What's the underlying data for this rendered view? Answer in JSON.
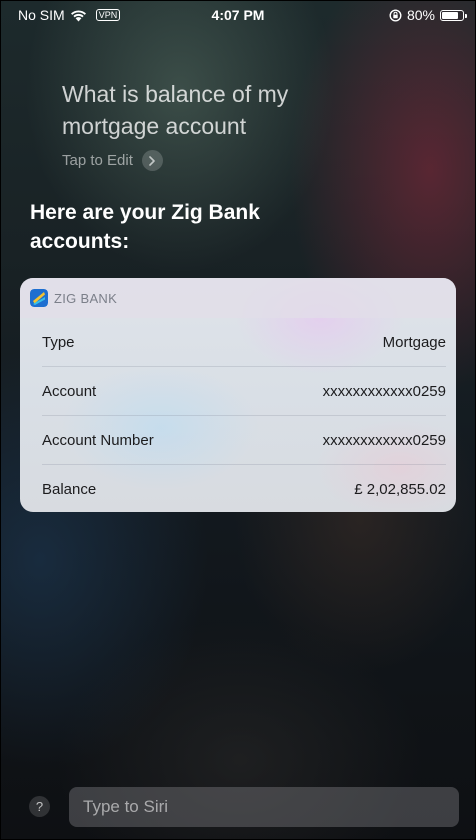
{
  "status_bar": {
    "carrier": "No SIM",
    "vpn": "VPN",
    "time": "4:07 PM",
    "battery_text": "80%",
    "battery_level": 0.8,
    "icons": [
      "wifi-icon",
      "rotation-lock-icon",
      "battery-icon"
    ]
  },
  "siri": {
    "query": "What is balance of my mortgage account",
    "tap_to_edit": "Tap to Edit",
    "response": "Here are your Zig Bank accounts:"
  },
  "card": {
    "app_name": "ZIG BANK",
    "rows": [
      {
        "label": "Type",
        "value": "Mortgage"
      },
      {
        "label": "Account",
        "value": "xxxxxxxxxxxx0259"
      },
      {
        "label": "Account Number",
        "value": "xxxxxxxxxxxx0259"
      },
      {
        "label": "Balance",
        "value": "£ 2,02,855.02"
      }
    ]
  },
  "bottom": {
    "help": "?",
    "input_placeholder": "Type to Siri"
  },
  "colors": {
    "card_bg": "#dfe3e9",
    "header_text": "#7b7f89",
    "logo_blue": "#1e6fd0",
    "logo_yellow": "#f2c230"
  }
}
